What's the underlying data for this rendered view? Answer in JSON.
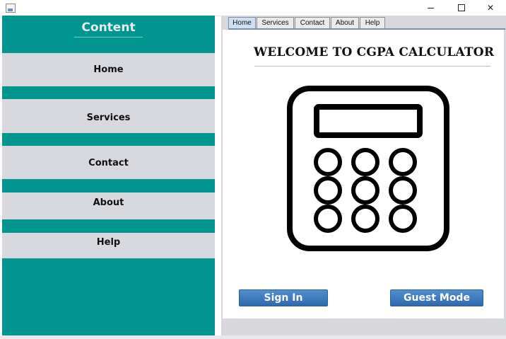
{
  "window": {
    "icon": "java-app-icon",
    "controls": [
      "minimize-icon",
      "maximize-icon",
      "close-icon"
    ]
  },
  "sidebar": {
    "title": "Content",
    "items": [
      {
        "label": "Home"
      },
      {
        "label": "Services"
      },
      {
        "label": "Contact"
      },
      {
        "label": "About"
      },
      {
        "label": "Help"
      }
    ]
  },
  "tabs": [
    {
      "label": "Home",
      "active": true
    },
    {
      "label": "Services",
      "active": false
    },
    {
      "label": "Contact",
      "active": false
    },
    {
      "label": "About",
      "active": false
    },
    {
      "label": "Help",
      "active": false
    }
  ],
  "main": {
    "title": "WELCOME TO CGPA CALCULATOR",
    "illustration": "calculator-icon",
    "sign_in_label": "Sign In",
    "guest_label": "Guest Mode"
  },
  "colors": {
    "sidebar": "#00968f",
    "nav_item": "#d8d9df",
    "button": "#3a78bf"
  }
}
